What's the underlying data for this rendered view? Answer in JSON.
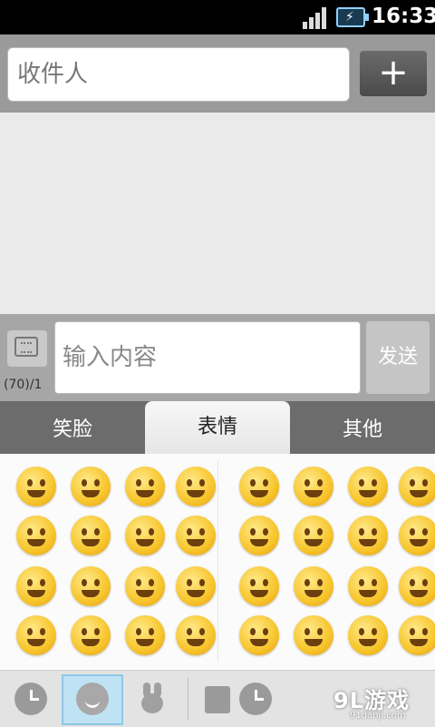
{
  "status_bar": {
    "time": "16:33"
  },
  "recipient": {
    "placeholder": "收件人",
    "add_label": "+"
  },
  "compose": {
    "char_count": "(70)/1",
    "placeholder": "输入内容",
    "send_label": "发送"
  },
  "emoji_tabs": [
    {
      "label": "笑脸",
      "active": false
    },
    {
      "label": "表情",
      "active": true
    },
    {
      "label": "其他",
      "active": false
    }
  ],
  "emoji_rows": 4,
  "emoji_columns": 8,
  "bottom_bar": {
    "icons": [
      "recent-icon",
      "smiley-category-icon",
      "bunny-icon",
      "box-icon",
      "recent-icon-2"
    ],
    "selected": "smiley-category-icon"
  },
  "watermark": {
    "logo": "9L游戏",
    "site": "91danji.com"
  },
  "colors": {
    "accent_blue": "#8cc7e6",
    "emoji_yellow": "#f7c52b"
  }
}
